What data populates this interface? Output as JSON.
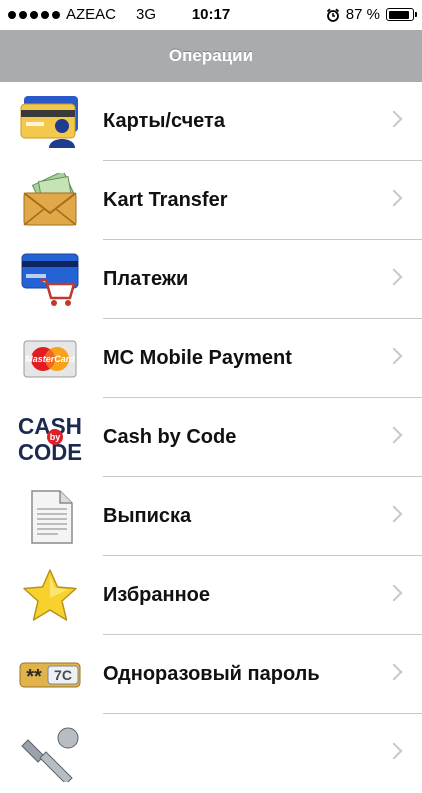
{
  "status_bar": {
    "carrier": "AZEAC",
    "network": "3G",
    "time": "10:17",
    "alarm_icon": "alarm-clock-icon",
    "battery_percent": "87 %",
    "battery_level": 0.87
  },
  "nav": {
    "title": "Операции"
  },
  "menu": [
    {
      "label": "Карты/счета",
      "icon": "card-user-icon"
    },
    {
      "label": "Kart Transfer",
      "icon": "money-envelope-icon"
    },
    {
      "label": "Платежи",
      "icon": "card-cart-icon"
    },
    {
      "label": "MC Mobile Payment",
      "icon": "mastercard-icon",
      "icon_text": "MasterCard"
    },
    {
      "label": "Cash by Code",
      "icon": "cash-by-code-icon",
      "icon_text": [
        "CASH",
        "by",
        "CODE"
      ]
    },
    {
      "label": "Выписка",
      "icon": "document-icon"
    },
    {
      "label": "Избранное",
      "icon": "star-icon"
    },
    {
      "label": "Одноразовый пароль",
      "icon": "password-badge-icon",
      "icon_text": [
        "**",
        "7C"
      ]
    },
    {
      "label": "",
      "icon": "wrench-icon"
    }
  ],
  "colors": {
    "nav_background": "#a9acaf",
    "separator": "#c8c7cc",
    "chevron": "#c7c7cc"
  }
}
